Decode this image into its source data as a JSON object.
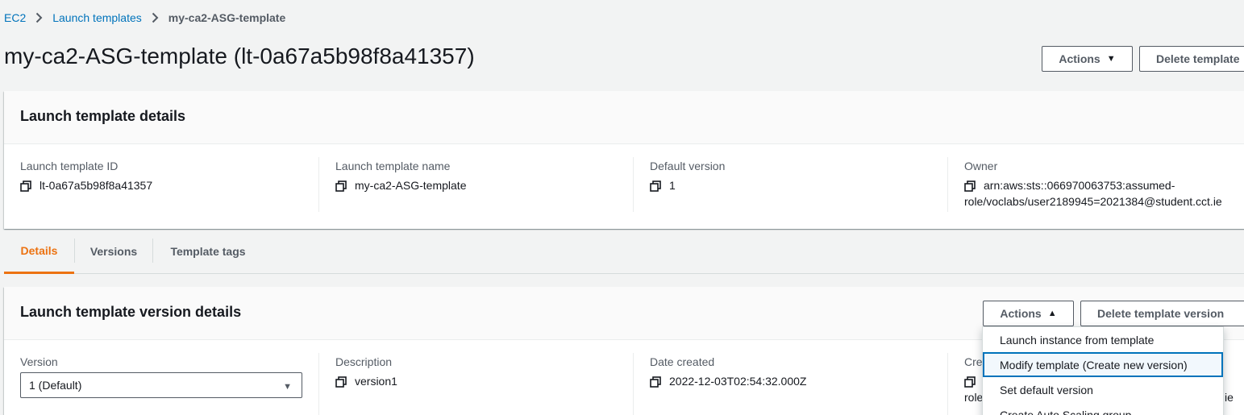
{
  "breadcrumb": {
    "items": [
      "EC2",
      "Launch templates"
    ],
    "current": "my-ca2-ASG-template"
  },
  "header": {
    "title": "my-ca2-ASG-template (lt-0a67a5b98f8a41357)",
    "actions_label": "Actions",
    "delete_label": "Delete template"
  },
  "details_panel": {
    "title": "Launch template details",
    "fields": [
      {
        "label": "Launch template ID",
        "value": "lt-0a67a5b98f8a41357"
      },
      {
        "label": "Launch template name",
        "value": "my-ca2-ASG-template"
      },
      {
        "label": "Default version",
        "value": "1"
      },
      {
        "label": "Owner",
        "value_line1": "arn:aws:sts::066970063753:assumed-",
        "value_line2": "role/voclabs/user2189945=2021384@student.cct.ie"
      }
    ]
  },
  "tabs": [
    {
      "label": "Details",
      "active": true
    },
    {
      "label": "Versions",
      "active": false
    },
    {
      "label": "Template tags",
      "active": false
    }
  ],
  "version_panel": {
    "title": "Launch template version details",
    "actions_label": "Actions",
    "delete_label": "Delete template version",
    "version": {
      "label": "Version",
      "selected": "1 (Default)"
    },
    "description": {
      "label": "Description",
      "value": "version1"
    },
    "date_created": {
      "label": "Date created",
      "value": "2022-12-03T02:54:32.000Z"
    },
    "created_by": {
      "label": "Crea",
      "value_line2_start": "role",
      "value_line2_end": "ie"
    }
  },
  "actions_menu": {
    "items": [
      "Launch instance from template",
      "Modify template (Create new version)",
      "Set default version",
      "Create Auto Scaling group"
    ],
    "focused_index": 1
  },
  "colors": {
    "link": "#0073bb",
    "accent": "#ec7211",
    "background": "#f2f3f3"
  },
  "icons": [
    "chevron-right-icon",
    "copy-icon",
    "caret-down-icon",
    "caret-up-icon"
  ]
}
